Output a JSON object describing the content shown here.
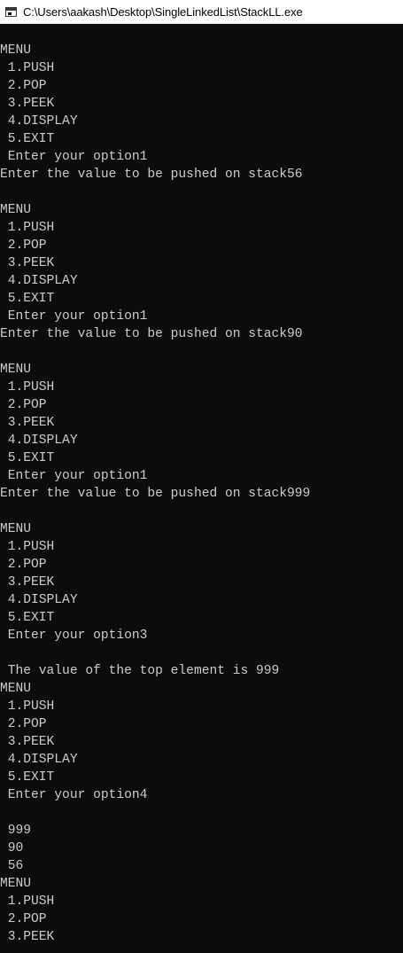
{
  "window": {
    "title": "C:\\Users\\aakash\\Desktop\\SingleLinkedList\\StackLL.exe",
    "icon": "console-app-icon"
  },
  "colors": {
    "console_background": "#0c0c0c",
    "console_text": "#cccccc",
    "titlebar_background": "#ffffff"
  },
  "console": {
    "lines": [
      "MENU",
      " 1.PUSH",
      " 2.POP",
      " 3.PEEK",
      " 4.DISPLAY",
      " 5.EXIT",
      " Enter your option1",
      "Enter the value to be pushed on stack56",
      "",
      "MENU",
      " 1.PUSH",
      " 2.POP",
      " 3.PEEK",
      " 4.DISPLAY",
      " 5.EXIT",
      " Enter your option1",
      "Enter the value to be pushed on stack90",
      "",
      "MENU",
      " 1.PUSH",
      " 2.POP",
      " 3.PEEK",
      " 4.DISPLAY",
      " 5.EXIT",
      " Enter your option1",
      "Enter the value to be pushed on stack999",
      "",
      "MENU",
      " 1.PUSH",
      " 2.POP",
      " 3.PEEK",
      " 4.DISPLAY",
      " 5.EXIT",
      " Enter your option3",
      "",
      " The value of the top element is 999",
      "MENU",
      " 1.PUSH",
      " 2.POP",
      " 3.PEEK",
      " 4.DISPLAY",
      " 5.EXIT",
      " Enter your option4",
      "",
      " 999",
      " 90",
      " 56",
      "MENU",
      " 1.PUSH",
      " 2.POP",
      " 3.PEEK"
    ]
  }
}
